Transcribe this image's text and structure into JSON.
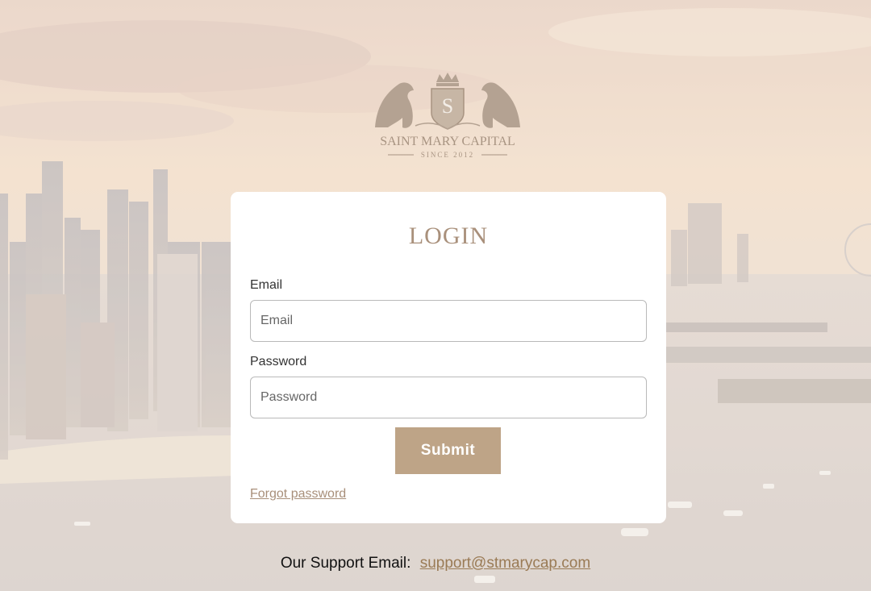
{
  "brand": {
    "name": "SAINT MARY CAPITAL",
    "since": "SINCE 2012",
    "monogram": "S"
  },
  "login": {
    "title": "LOGIN",
    "email_label": "Email",
    "email_placeholder": "Email",
    "email_value": "",
    "password_label": "Password",
    "password_placeholder": "Password",
    "password_value": "",
    "submit_label": "Submit",
    "forgot_label": "Forgot password"
  },
  "footer": {
    "support_label": "Our Support Email:",
    "support_email": "support@stmarycap.com"
  },
  "colors": {
    "accent": "#bea487",
    "title": "#a9907b",
    "link": "#9a7b55"
  }
}
